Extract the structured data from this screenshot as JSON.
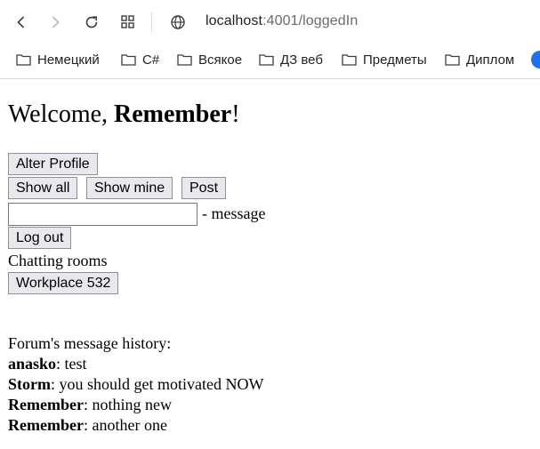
{
  "browser": {
    "url_host": "localhost",
    "url_rest": ":4001/loggedIn",
    "bookmarks": [
      "Немецкий",
      "C#",
      "Всякое",
      "ДЗ веб",
      "Предметы",
      "Диплом"
    ]
  },
  "page": {
    "welcome_prefix": "Welcome, ",
    "username": "Remember",
    "welcome_suffix": "!",
    "alter_profile_label": "Alter Profile",
    "show_all_label": "Show all",
    "show_mine_label": "Show mine",
    "post_label": "Post",
    "message_input_value": "",
    "message_hint": "- message",
    "logout_label": "Log out",
    "rooms_heading": "Chatting rooms",
    "rooms": [
      "Workplace 532"
    ],
    "history_heading": "Forum's message history:",
    "messages": [
      {
        "author": "anasko",
        "text": ": test"
      },
      {
        "author": "Storm",
        "text": ": you should get motivated NOW"
      },
      {
        "author": "Remember",
        "text": ": nothing new"
      },
      {
        "author": "Remember",
        "text": ": another one"
      }
    ]
  }
}
